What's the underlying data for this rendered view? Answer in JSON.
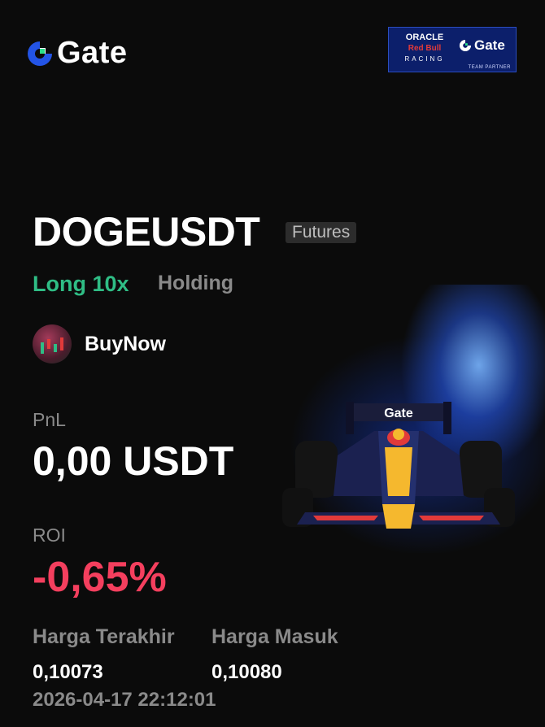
{
  "brand": {
    "name": "Gate"
  },
  "partner": {
    "line1": "ORACLE",
    "line2": "Red Bull",
    "line3": "RACING",
    "brand": "Gate",
    "caption": "TEAM PARTNER"
  },
  "position": {
    "pair": "DOGEUSDT",
    "market_tag": "Futures",
    "direction": "Long 10x",
    "status": "Holding"
  },
  "user": {
    "name": "BuyNow"
  },
  "pnl": {
    "label": "PnL",
    "value": "0,00 USDT"
  },
  "roi": {
    "label": "ROI",
    "value": "-0,65%"
  },
  "prices": {
    "last_label": "Harga Terakhir",
    "last_value": "0,10073",
    "entry_label": "Harga Masuk",
    "entry_value": "0,10080"
  },
  "timestamp": "2026-04-17 22:12:01",
  "car_livery": {
    "wing": "Gate"
  },
  "colors": {
    "long": "#2fbd85",
    "roi_negative": "#f43f5e",
    "muted": "#8a8a8a",
    "brand_blue": "#2354e6"
  }
}
